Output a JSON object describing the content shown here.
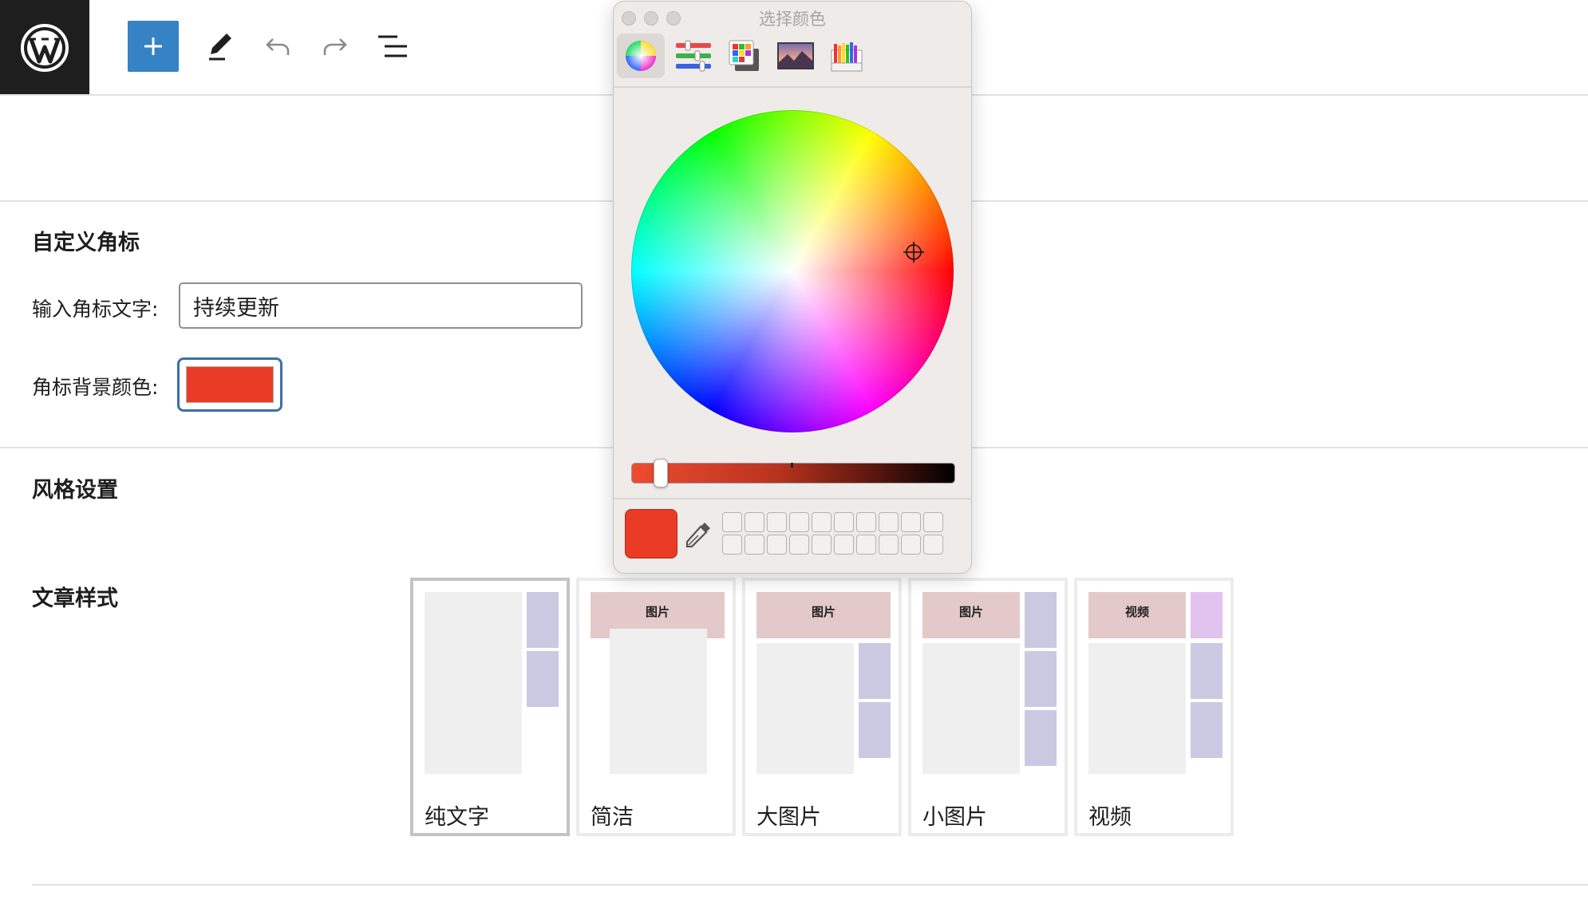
{
  "toolbar": {
    "logo": "wordpress-logo",
    "icons": [
      "plus-icon",
      "pencil-icon",
      "undo-icon",
      "redo-icon",
      "list-view-icon"
    ]
  },
  "custom_badge": {
    "section_title": "自定义角标",
    "text_label": "输入角标文字:",
    "text_value": "持续更新",
    "bg_label": "角标背景颜色:",
    "bg_color": "#ea3b26"
  },
  "style_settings": {
    "section_title": "风格设置"
  },
  "post_style": {
    "label": "文章样式",
    "options": [
      {
        "label": "纯文字",
        "tag": "",
        "selected": true
      },
      {
        "label": "简洁",
        "tag": "图片",
        "selected": false
      },
      {
        "label": "大图片",
        "tag": "图片",
        "selected": false
      },
      {
        "label": "小图片",
        "tag": "图片",
        "selected": false
      },
      {
        "label": "视频",
        "tag": "视频",
        "selected": false
      }
    ]
  },
  "color_picker": {
    "title": "选择颜色",
    "tabs": [
      "color-wheel-icon",
      "sliders-icon",
      "palettes-icon",
      "image-palette-icon",
      "pencils-icon"
    ],
    "active_tab": "color-wheel-icon",
    "current_color": "#ea3b26",
    "brightness": 0.92,
    "swatch_wells": 20
  },
  "colors": {
    "accent": "#3582c4",
    "focus_border": "#3b6fb0",
    "wp_dark": "#1e1e1e"
  }
}
